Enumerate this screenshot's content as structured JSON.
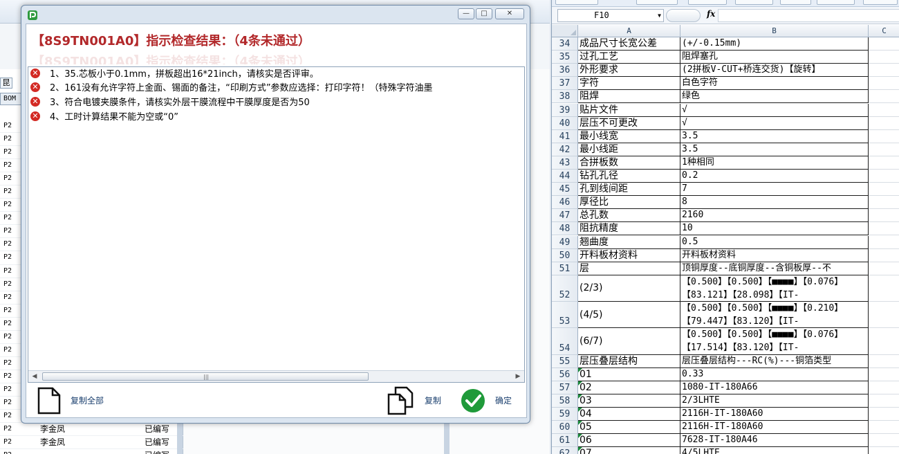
{
  "background_app": {
    "tab_label": "昆",
    "bom_label": "BOM",
    "rows": [
      {
        "code": "P2",
        "name": "",
        "status": ""
      },
      {
        "code": "P2",
        "name": "",
        "status": ""
      },
      {
        "code": "P2",
        "name": "",
        "status": ""
      },
      {
        "code": "P2",
        "name": "",
        "status": ""
      },
      {
        "code": "P2",
        "name": "",
        "status": ""
      },
      {
        "code": "P2",
        "name": "",
        "status": ""
      },
      {
        "code": "P2",
        "name": "",
        "status": ""
      },
      {
        "code": "P2",
        "name": "",
        "status": ""
      },
      {
        "code": "P2",
        "name": "",
        "status": ""
      },
      {
        "code": "P2",
        "name": "",
        "status": ""
      },
      {
        "code": "P2",
        "name": "",
        "status": ""
      },
      {
        "code": "P2",
        "name": "",
        "status": ""
      },
      {
        "code": "P2",
        "name": "",
        "status": ""
      },
      {
        "code": "P2",
        "name": "",
        "status": ""
      },
      {
        "code": "P2",
        "name": "",
        "status": ""
      },
      {
        "code": "P2",
        "name": "",
        "status": ""
      },
      {
        "code": "P2",
        "name": "",
        "status": ""
      },
      {
        "code": "P2",
        "name": "",
        "status": ""
      },
      {
        "code": "P2",
        "name": "",
        "status": ""
      },
      {
        "code": "P2",
        "name": "",
        "status": ""
      },
      {
        "code": "P2",
        "name": "",
        "status": ""
      },
      {
        "code": "P2",
        "name": "",
        "status": ""
      },
      {
        "code": "P2",
        "name": "",
        "status": ""
      },
      {
        "code": "P2",
        "name": "李金凤",
        "status": "已编写"
      },
      {
        "code": "P2",
        "name": "李金凤",
        "status": "已编写"
      },
      {
        "code": "P2",
        "name": "",
        "status": "已编写"
      }
    ]
  },
  "dialog": {
    "title": "【8S9TN001A0】指示检查结果：（4条未通过）",
    "ghost_title": "【8S9TN001A0】指示检查结果：（4条未通过）",
    "window_buttons": {
      "minimize": "—",
      "maximize": "□",
      "close": "✕"
    },
    "messages": [
      "1、35.芯板小于0.1mm，拼板超出16*21inch，请核实是否评审。",
      "2、161没有允许字符上金面、锡面的备注，“印刷方式”参数应选择：打印字符！（特殊字符油墨",
      "3、符合电镀夹膜条件，请核实外层干膜流程中干膜厚度是否为50",
      "4、工时计算结果不能为空或“0”"
    ],
    "buttons": {
      "copy_all": "复制全部",
      "copy": "复制",
      "confirm": "确定"
    },
    "colors": {
      "title": "#b2282a",
      "error_icon": "#d32a24",
      "confirm_icon": "#1f9a3a"
    }
  },
  "excel": {
    "name_box": "F10",
    "fx_label": "fx",
    "columns": [
      "A",
      "B",
      "C"
    ],
    "rows": [
      {
        "num": "34",
        "a": "成品尺寸长宽公差",
        "b": "(+/-0.15mm)"
      },
      {
        "num": "35",
        "a": "过孔工艺",
        "b": "阻焊塞孔"
      },
      {
        "num": "36",
        "a": "外形要求",
        "b": "(2拼板V-CUT+桥连交货)【旋转】"
      },
      {
        "num": "37",
        "a": "字符",
        "b": "白色字符"
      },
      {
        "num": "38",
        "a": "阻焊",
        "b": "绿色"
      },
      {
        "num": "39",
        "a": "贴片文件",
        "b": "√"
      },
      {
        "num": "40",
        "a": "层压不可更改",
        "b": "√"
      },
      {
        "num": "41",
        "a": "最小线宽",
        "b": "3.5"
      },
      {
        "num": "42",
        "a": "最小线距",
        "b": "3.5"
      },
      {
        "num": "43",
        "a": "合拼板数",
        "b": "1种相同"
      },
      {
        "num": "44",
        "a": "钻孔孔径",
        "b": "0.2"
      },
      {
        "num": "45",
        "a": "孔到线间距",
        "b": "7"
      },
      {
        "num": "46",
        "a": "厚径比",
        "b": "8"
      },
      {
        "num": "47",
        "a": "总孔数",
        "b": "2160"
      },
      {
        "num": "48",
        "a": "阻抗精度",
        "b": "10"
      },
      {
        "num": "49",
        "a": "翘曲度",
        "b": "0.5"
      },
      {
        "num": "50",
        "a": "开料板材资料",
        "b": "开料板材资料"
      },
      {
        "num": "51",
        "a": "层",
        "b": "顶铜厚度--底铜厚度--含铜板厚--不"
      },
      {
        "num": "52",
        "a": "(2/3)",
        "b": "【0.500】【0.500】【■■■■】【0.076】【83.121】【28.098】【IT-"
      },
      {
        "num": "53",
        "a": "(4/5)",
        "b": "【0.500】【0.500】【■■■■】【0.210】【79.447】【83.120】【IT-"
      },
      {
        "num": "54",
        "a": "(6/7)",
        "b": "【0.500】【0.500】【■■■■】【0.076】【17.514】【83.120】【IT-"
      },
      {
        "num": "55",
        "a": "层压叠层结构",
        "b": "层压叠层结构---RC(%)---铜箔类型"
      },
      {
        "num": "56",
        "a": "01",
        "b": "0.33"
      },
      {
        "num": "57",
        "a": "02",
        "b": "1080-IT-180A66"
      },
      {
        "num": "58",
        "a": "03",
        "b": "2/3LHTE"
      },
      {
        "num": "59",
        "a": "04",
        "b": "2116H-IT-180A60"
      },
      {
        "num": "60",
        "a": "05",
        "b": "2116H-IT-180A60"
      },
      {
        "num": "61",
        "a": "06",
        "b": "7628-IT-180A46"
      },
      {
        "num": "62",
        "a": "07",
        "b": "4/5LHTE"
      }
    ]
  }
}
